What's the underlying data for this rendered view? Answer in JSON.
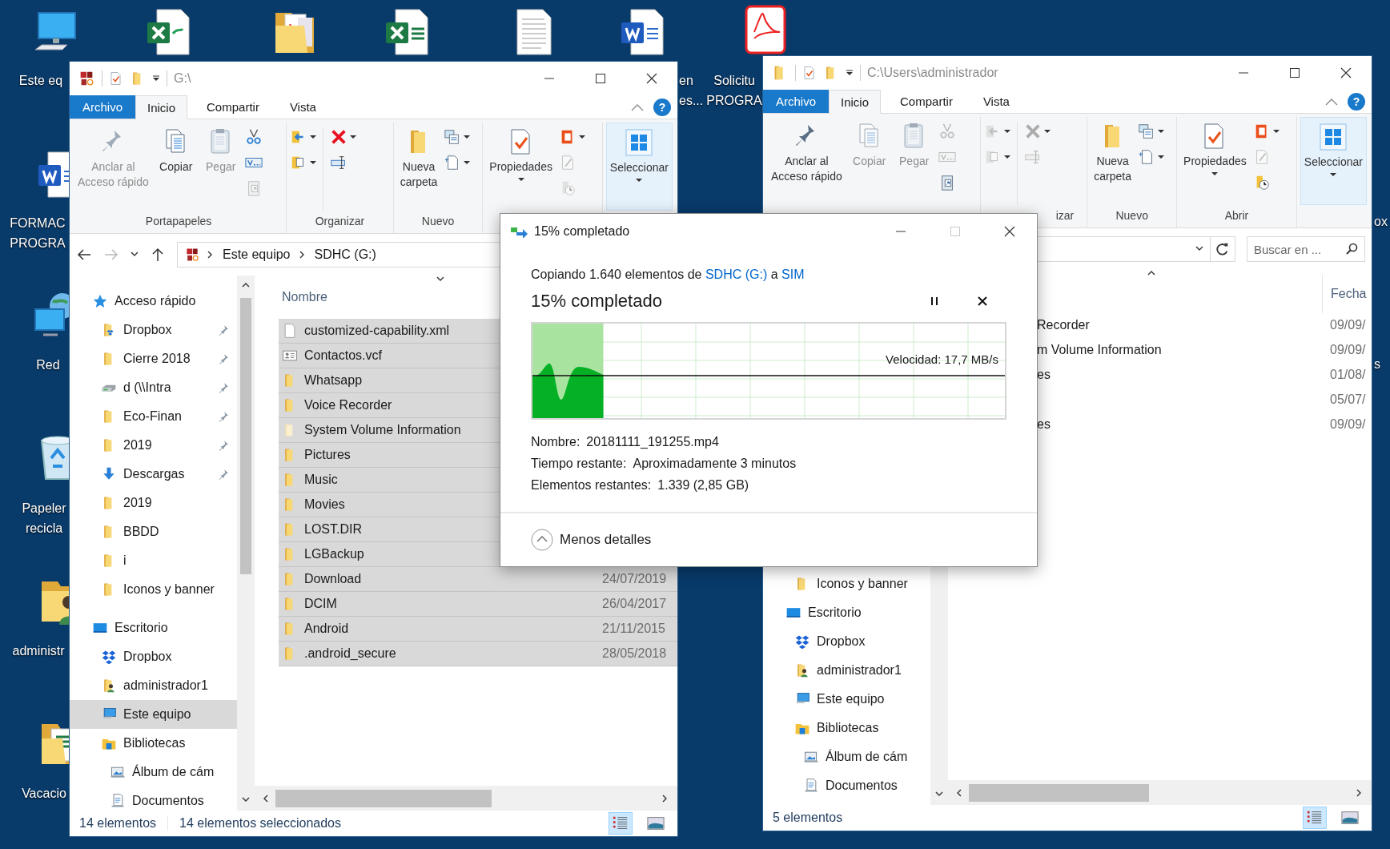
{
  "desktop": {
    "icons": [
      {
        "kind": "computer",
        "label": [
          "Este eq"
        ]
      },
      {
        "kind": "word",
        "label": [
          "FORMAC",
          "PROGRA"
        ]
      },
      {
        "kind": "network",
        "label": [
          "Red"
        ]
      },
      {
        "kind": "recycle-bin",
        "label": [
          "Papeler",
          "recicla"
        ]
      },
      {
        "kind": "user-folder",
        "label": [
          "administr"
        ]
      },
      {
        "kind": "sheet-folder",
        "label": [
          "Vacacio"
        ]
      },
      {
        "kind": "excel"
      },
      {
        "kind": "pdf-folder"
      },
      {
        "kind": "excel-table"
      },
      {
        "kind": "text-doc"
      },
      {
        "kind": "word",
        "label": [
          "en",
          "es..."
        ]
      },
      {
        "kind": "pdf",
        "label": [
          "Solicitu",
          "PROGRA"
        ]
      }
    ],
    "label_fragments": [
      "ox",
      "s"
    ]
  },
  "windows": [
    {
      "title": "G:\\",
      "help": "?",
      "tabs": [
        {
          "label": "Archivo",
          "kind": "file-menu",
          "selected": false
        },
        {
          "label": "Inicio",
          "selected": true
        },
        {
          "label": "Compartir",
          "selected": false
        },
        {
          "label": "Vista",
          "selected": false
        }
      ],
      "ribbon": [
        {
          "label": "Portapapeles",
          "buttons": [
            {
              "label": "Anclar al\nAcceso rápido",
              "disabled": true,
              "dropdown": false
            },
            {
              "label": "Copiar",
              "disabled": false,
              "dropdown": false
            },
            {
              "label": "Pegar",
              "disabled": true,
              "dropdown": false
            }
          ],
          "tools": [
            [
              {
                "disabled": false
              },
              {
                "disabled": false
              },
              {
                "disabled": true
              }
            ]
          ]
        },
        {
          "label": "Organizar",
          "tools": [
            [
              {
                "disabled": false
              },
              {
                "disabled": false
              }
            ],
            [
              {
                "disabled": false
              },
              {
                "disabled": false
              }
            ]
          ]
        },
        {
          "label": "Nuevo",
          "buttons": [
            {
              "label": "Nueva\ncarpeta",
              "disabled": false,
              "dropdown": false
            }
          ],
          "tools": [
            [
              {
                "disabled": false
              },
              {
                "disabled": false
              }
            ]
          ]
        },
        {
          "buttons": [
            {
              "label": "Propiedades",
              "disabled": false,
              "dropdown": true
            }
          ],
          "tools": [
            [
              {
                "disabled": false
              },
              {
                "disabled": true
              },
              {
                "disabled": true
              }
            ]
          ]
        },
        {
          "buttons": [
            {
              "label": "Seleccionar",
              "disabled": false,
              "dropdown": true,
              "hovered": true
            }
          ]
        }
      ],
      "address": {
        "crumbs": [
          "Este equipo",
          "SDHC (G:)"
        ]
      },
      "nav": [
        {
          "label": "Acceso rápido",
          "kind": "star",
          "selected": false,
          "children": [
            {
              "label": "Dropbox",
              "kind": "dropbox-folder",
              "pinned": true,
              "selected": false
            },
            {
              "label": "Cierre 2018",
              "kind": "folder",
              "pinned": true,
              "selected": false
            },
            {
              "label": "d (\\\\Intra",
              "kind": "drive",
              "pinned": true,
              "selected": false
            },
            {
              "label": "Eco-Finan",
              "kind": "folder",
              "pinned": true,
              "selected": false
            },
            {
              "label": "2019",
              "kind": "folder",
              "pinned": true,
              "selected": false
            },
            {
              "label": "Descargas",
              "kind": "download",
              "pinned": true,
              "selected": false
            },
            {
              "label": "2019",
              "kind": "folder",
              "pinned": false,
              "selected": false
            },
            {
              "label": "BBDD",
              "kind": "folder",
              "pinned": false,
              "selected": false
            },
            {
              "label": "i",
              "kind": "folder",
              "pinned": false,
              "selected": false
            },
            {
              "label": "Iconos y banner",
              "kind": "folder",
              "pinned": false,
              "selected": false
            }
          ]
        },
        {
          "label": "Escritorio",
          "kind": "desktop",
          "selected": false,
          "children": [
            {
              "label": "Dropbox",
              "kind": "dropbox",
              "selected": false
            },
            {
              "label": "administrador1",
              "kind": "user-folder",
              "selected": false
            },
            {
              "label": "Este equipo",
              "kind": "computer",
              "selected": true
            },
            {
              "label": "Bibliotecas",
              "kind": "library",
              "selected": false,
              "children": [
                {
                  "label": "Álbum de cám",
                  "kind": "picture-library",
                  "selected": false
                },
                {
                  "label": "Documentos",
                  "kind": "document-library",
                  "selected": false
                }
              ]
            }
          ]
        }
      ],
      "files": {
        "columns": [
          {
            "kind": "name",
            "label": "Nombre"
          }
        ],
        "rows": [
          {
            "kind": "file",
            "name": "customized-capability.xml",
            "selected": true
          },
          {
            "kind": "contact",
            "name": "Contactos.vcf",
            "selected": true
          },
          {
            "kind": "folder",
            "name": "Whatsapp",
            "selected": true
          },
          {
            "kind": "folder",
            "name": "Voice Recorder",
            "selected": true
          },
          {
            "kind": "hidden-folder",
            "name": "System Volume Information",
            "selected": true
          },
          {
            "kind": "folder",
            "name": "Pictures",
            "selected": true
          },
          {
            "kind": "folder",
            "name": "Music",
            "selected": true
          },
          {
            "kind": "folder",
            "name": "Movies",
            "selected": true
          },
          {
            "kind": "folder",
            "name": "LOST.DIR",
            "selected": true
          },
          {
            "kind": "folder",
            "name": "LGBackup",
            "selected": true
          },
          {
            "kind": "folder",
            "name": "Download",
            "date": "24/07/2019",
            "selected": true
          },
          {
            "kind": "folder",
            "name": "DCIM",
            "date": "26/04/2017",
            "selected": true
          },
          {
            "kind": "folder",
            "name": "Android",
            "date": "21/11/2015",
            "selected": true
          },
          {
            "kind": "folder",
            "name": ".android_secure",
            "date": "28/05/2018",
            "selected": true
          }
        ]
      },
      "status": [
        "14 elementos",
        "14 elementos seleccionados"
      ],
      "views": [
        {
          "selected": true
        },
        {
          "selected": false
        }
      ]
    },
    {
      "title": "C:\\Users\\administrador",
      "help": "?",
      "tabs": [
        {
          "label": "Archivo",
          "kind": "file-menu",
          "selected": false
        },
        {
          "label": "Inicio",
          "selected": true
        },
        {
          "label": "Compartir",
          "selected": false
        },
        {
          "label": "Vista",
          "selected": false
        }
      ],
      "ribbon": [
        {
          "buttons": [
            {
              "label": "Anclar al\nAcceso rápido",
              "disabled": false,
              "dropdown": false
            },
            {
              "label": "Copiar",
              "disabled": true,
              "dropdown": false
            },
            {
              "label": "Pegar",
              "disabled": true,
              "dropdown": false
            }
          ],
          "tools": [
            [
              {
                "disabled": true
              },
              {
                "disabled": true
              },
              {
                "disabled": false
              }
            ]
          ]
        },
        {
          "label": "izar",
          "tools": [
            [
              {
                "disabled": true
              },
              {
                "disabled": true
              }
            ],
            [
              {
                "disabled": true
              },
              {
                "disabled": true
              }
            ]
          ]
        },
        {
          "label": "Nuevo",
          "buttons": [
            {
              "label": "Nueva\ncarpeta",
              "disabled": false,
              "dropdown": false
            }
          ],
          "tools": [
            [
              {
                "disabled": false
              },
              {
                "disabled": false
              }
            ]
          ]
        },
        {
          "label": "Abrir",
          "buttons": [
            {
              "label": "Propiedades",
              "disabled": false,
              "dropdown": true
            }
          ],
          "tools": [
            [
              {
                "disabled": false
              },
              {
                "disabled": true
              },
              {
                "disabled": false
              }
            ]
          ]
        },
        {
          "buttons": [
            {
              "label": "Seleccionar",
              "disabled": false,
              "dropdown": true,
              "hovered": true
            }
          ]
        }
      ],
      "address": {
        "search": {
          "placeholder": "Buscar en ..."
        }
      },
      "nav": [
        {
          "children": [
            {
              "label": "Iconos y banner",
              "kind": "folder",
              "pinned": false,
              "selected": false
            }
          ]
        },
        {
          "label": "Escritorio",
          "kind": "desktop",
          "selected": false,
          "children": [
            {
              "label": "Dropbox",
              "kind": "dropbox",
              "selected": false
            },
            {
              "label": "administrador1",
              "kind": "user-folder",
              "selected": false
            },
            {
              "label": "Este equipo",
              "kind": "computer",
              "selected": false
            },
            {
              "label": "Bibliotecas",
              "kind": "library",
              "selected": false,
              "children": [
                {
                  "label": "Álbum de cám",
                  "kind": "picture-library",
                  "selected": false
                },
                {
                  "label": "Documentos",
                  "kind": "document-library",
                  "selected": false
                }
              ]
            }
          ]
        }
      ],
      "files": {
        "columns": [
          {
            "kind": "date",
            "label": "Fecha"
          }
        ],
        "rows": [
          {
            "name": "Recorder",
            "date": "09/09/",
            "selected": false
          },
          {
            "name": "m Volume Information",
            "date": "09/09/",
            "selected": false
          },
          {
            "name": "es",
            "date": "01/08/",
            "selected": false
          },
          {
            "date": "05/07/",
            "selected": false
          },
          {
            "name": "es",
            "date": "09/09/",
            "selected": false
          }
        ]
      },
      "status": [
        "5 elementos"
      ],
      "views": [
        {
          "selected": true
        },
        {
          "selected": false
        }
      ]
    }
  ],
  "dialog": {
    "title": "15% completado",
    "summary": [
      {
        "kind": "text",
        "text": "Copiando 1.640 elementos de "
      },
      {
        "kind": "link",
        "text": "SDHC (G:)"
      },
      {
        "kind": "text",
        "text": " a "
      },
      {
        "kind": "link",
        "text": "SIM"
      }
    ],
    "heading": "15% completado",
    "progress": {
      "level": 0.15,
      "speed": "Velocidad: 17,7 MB/s"
    },
    "details": [
      {
        "label": "Nombre:",
        "value": "20181111_191255.mp4"
      },
      {
        "label": "Tiempo restante:",
        "value": "Aproximadamente 3 minutos"
      },
      {
        "label": "Elementos restantes:",
        "value": "1.339 (2,85 GB)"
      }
    ],
    "toggle": "Menos detalles"
  }
}
